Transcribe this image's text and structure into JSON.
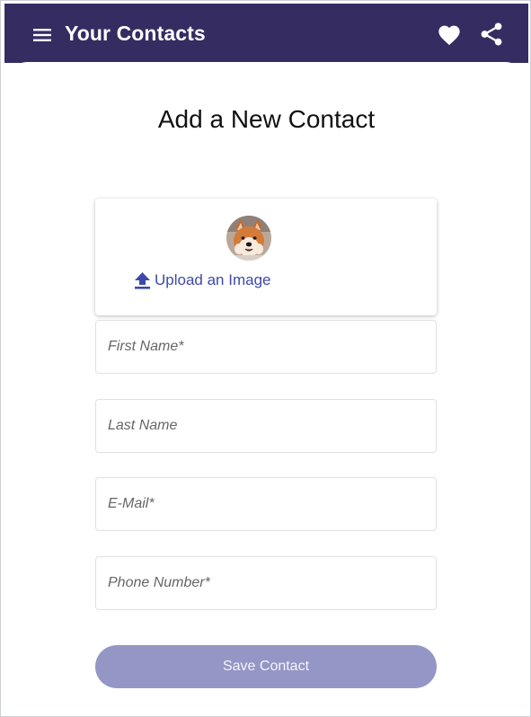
{
  "appbar": {
    "title": "Your Contacts",
    "menu_icon": "menu-icon",
    "favorite_icon": "heart-icon",
    "share_icon": "share-icon",
    "background_color": "#352c62"
  },
  "form": {
    "title": "Add a New Contact",
    "upload_label": "Upload an Image",
    "upload_icon": "upload-icon",
    "avatar": "dog-avatar",
    "fields": {
      "first_name": {
        "placeholder": "First Name*",
        "value": ""
      },
      "last_name": {
        "placeholder": "Last Name",
        "value": ""
      },
      "email": {
        "placeholder": "E-Mail*",
        "value": ""
      },
      "phone": {
        "placeholder": "Phone Number*",
        "value": ""
      }
    },
    "save_label": "Save Contact",
    "accent_color": "#3e4aa8",
    "save_button_color": "#9497c5"
  }
}
